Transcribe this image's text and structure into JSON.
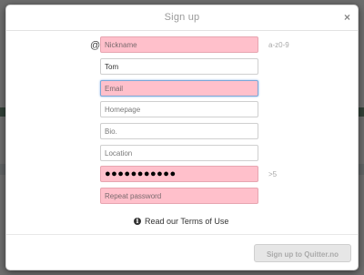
{
  "modal": {
    "title": "Sign up",
    "close_label": "×"
  },
  "form": {
    "nickname": {
      "placeholder": "Nickname",
      "hint": "a-z0-9",
      "prefix": "@"
    },
    "fullname": {
      "value": "Tom"
    },
    "email": {
      "placeholder": "Email"
    },
    "homepage": {
      "placeholder": "Homepage"
    },
    "bio": {
      "placeholder": "Bio."
    },
    "location": {
      "placeholder": "Location"
    },
    "password": {
      "value": "●●●●●●●●●●●",
      "hint": ">5"
    },
    "repeat_password": {
      "placeholder": "Repeat password"
    }
  },
  "terms": {
    "icon": "info-icon",
    "label": "Read our Terms of Use"
  },
  "submit": {
    "label": "Sign up to Quitter.no"
  },
  "colors": {
    "invalid_field": "#ffc0cb",
    "focus_border": "#7aa7d8"
  }
}
